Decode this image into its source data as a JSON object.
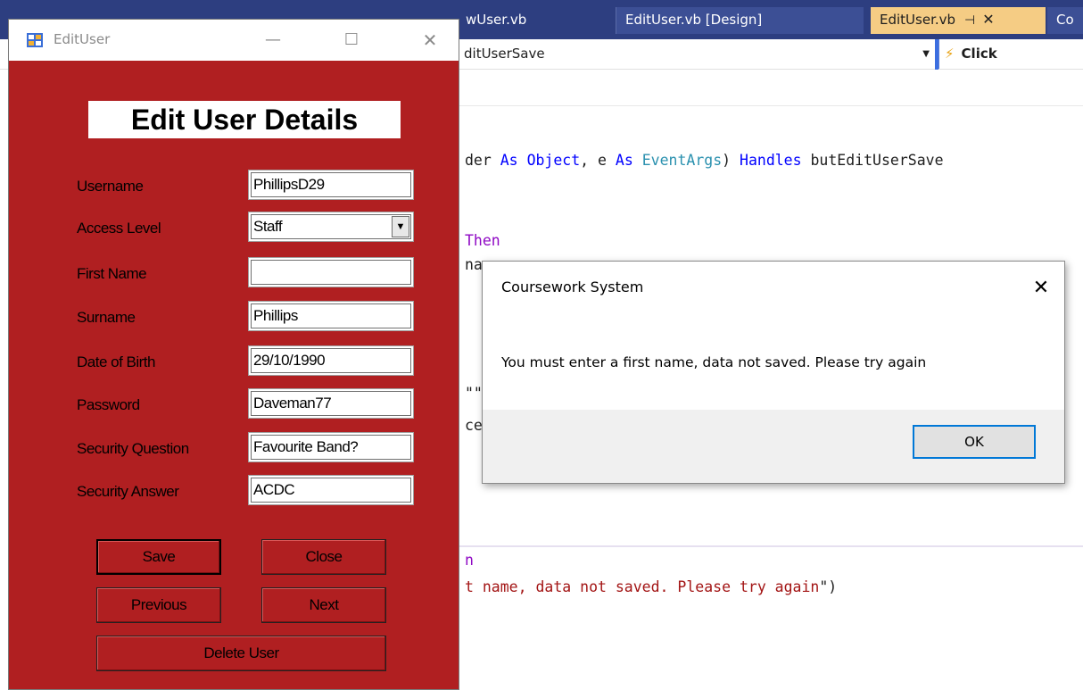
{
  "vs": {
    "tabs": [
      {
        "label": "wUser.vb"
      },
      {
        "label": "EditUser.vb [Design]"
      },
      {
        "label": "EditUser.vb",
        "active": true
      },
      {
        "label": "Co"
      }
    ],
    "pin_glyph": "⊣",
    "close_glyph": "✕",
    "nav_left": "ditUserSave",
    "nav_right": "Click",
    "code_lines": [
      {
        "segments": [
          [
            "der ",
            "n"
          ],
          [
            "As ",
            "kw"
          ],
          [
            "Object",
            "kw"
          ],
          [
            ", e ",
            "n"
          ],
          [
            "As ",
            "kw"
          ],
          [
            "EventArgs",
            "ty"
          ],
          [
            ") ",
            "n"
          ],
          [
            "Handles ",
            "kw"
          ],
          [
            "butEditUserSave",
            "n"
          ]
        ]
      },
      {
        "segments": [
          [
            "Then",
            "kw2"
          ]
        ]
      },
      {
        "segments": [
          [
            "na",
            "n"
          ]
        ]
      },
      {
        "segments": [
          [
            "\"\"",
            "n"
          ]
        ]
      },
      {
        "segments": [
          [
            "ce",
            "n"
          ]
        ]
      },
      {
        "segments": [
          [
            "n",
            "kw2"
          ]
        ]
      },
      {
        "segments": [
          [
            "t name, data not saved. Please try again",
            "str"
          ],
          [
            "\")",
            "n"
          ]
        ]
      }
    ]
  },
  "form": {
    "title": "EditUser",
    "heading": "Edit User Details",
    "fields": [
      {
        "label": "Username",
        "value": "PhillipsD29"
      },
      {
        "label": "Access Level",
        "value": "Staff"
      },
      {
        "label": "First Name",
        "value": ""
      },
      {
        "label": "Surname",
        "value": "Phillips"
      },
      {
        "label": "Date of Birth",
        "value": "29/10/1990"
      },
      {
        "label": "Password",
        "value": "Daveman77"
      },
      {
        "label": "Security Question",
        "value": "Favourite Band?"
      },
      {
        "label": "Security Answer",
        "value": "ACDC"
      }
    ],
    "buttons": {
      "save": "Save",
      "close": "Close",
      "previous": "Previous",
      "next": "Next",
      "delete": "Delete User"
    },
    "colors": {
      "background": "#b01f21"
    }
  },
  "msgbox": {
    "title": "Coursework System",
    "message": "You must enter a first name, data not saved. Please try again",
    "ok": "OK"
  }
}
